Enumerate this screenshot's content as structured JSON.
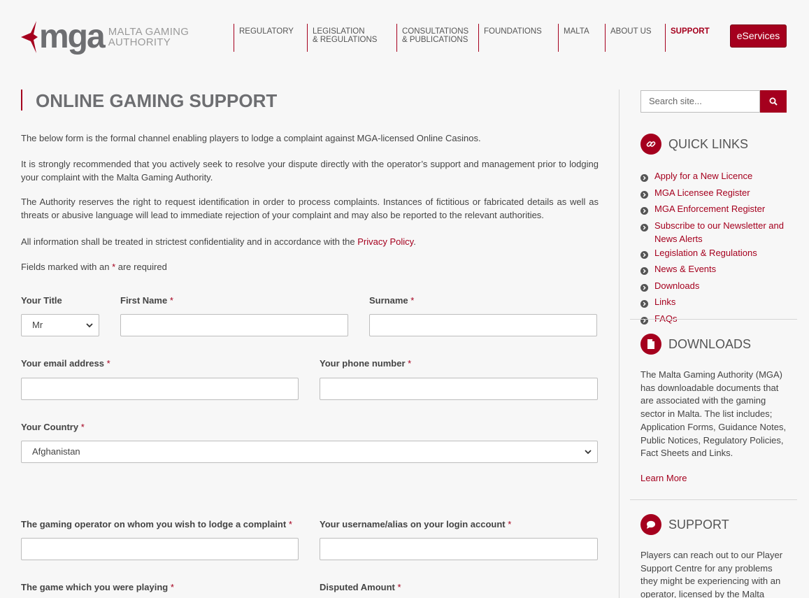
{
  "header": {
    "logo_mark": "mga",
    "logo_line1": "MALTA GAMING",
    "logo_line2": "AUTHORITY",
    "nav": [
      {
        "l1": "REGULATORY",
        "l2": ""
      },
      {
        "l1": "LEGISLATION",
        "l2": "& REGULATIONS"
      },
      {
        "l1": "CONSULTATIONS",
        "l2": "& PUBLICATIONS"
      },
      {
        "l1": "FOUNDATIONS",
        "l2": ""
      },
      {
        "l1": "MALTA",
        "l2": ""
      },
      {
        "l1": "ABOUT US",
        "l2": ""
      },
      {
        "l1": "SUPPORT",
        "l2": ""
      }
    ],
    "eservices": "eServices"
  },
  "main": {
    "title": "ONLINE GAMING SUPPORT",
    "p1": "The below form is the formal channel enabling players to lodge a complaint against MGA-licensed Online Casinos.",
    "p2": "It is strongly recommended that you actively seek to resolve your dispute directly with the operator’s support and management prior to lodging your complaint with the Malta Gaming Authority.",
    "p3": "The Authority reserves the right to request identification in order to process complaints. Instances of fictitious or fabricated details as well as threats or abusive language will lead to immediate rejection of your complaint and may also be reported to the relevant authorities.",
    "p4_before": "All information shall be treated in strictest confidentiality and in accordance with the ",
    "p4_link": "Privacy Policy",
    "p4_after": ".",
    "p5_before": "Fields marked with an ",
    "p5_star": "*",
    "p5_after": " are required"
  },
  "form": {
    "title_label": "Your Title",
    "title_value": "Mr",
    "first_name_label": "First Name",
    "surname_label": "Surname",
    "email_label": "Your email address",
    "phone_label": "Your phone number",
    "country_label": "Your Country",
    "country_value": "Afghanistan",
    "operator_label": "The gaming operator on whom you wish to lodge a complaint",
    "username_label": "Your username/alias on your login account",
    "game_label": "The game which you were playing",
    "amount_label": "Disputed Amount",
    "req": "*"
  },
  "sidebar": {
    "search_placeholder": "Search site...",
    "quick_links_title": "QUICK LINKS",
    "quick_links": [
      "Apply for a New Licence",
      "MGA Licensee Register",
      "MGA Enforcement Register",
      "Subscribe to our Newsletter and News Alerts",
      "Legislation & Regulations",
      "News & Events",
      "Downloads",
      "Links",
      "FAQs"
    ],
    "downloads_title": "DOWNLOADS",
    "downloads_text": "The Malta Gaming Authority (MGA) has downloadable documents that are associated with the gaming sector in Malta. The list includes; Application Forms, Guidance Notes, Public Notices, Regulatory Policies, Fact Sheets and Links.",
    "learn_more": "Learn More",
    "support_title": "SUPPORT",
    "support_text": "Players can reach out to our Player Support Centre for any problems they might be experiencing with an operator, licensed by the Malta"
  },
  "colors": {
    "accent": "#a5001e",
    "text": "#444444",
    "background": "#f7f7f7"
  }
}
